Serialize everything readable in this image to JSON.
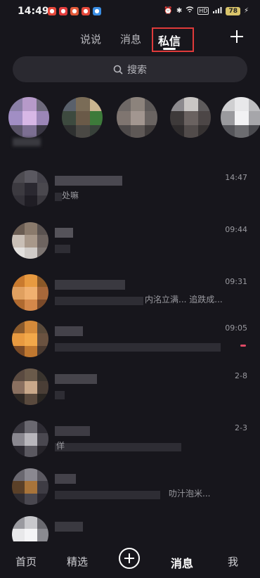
{
  "status_bar": {
    "time": "14:49",
    "signal_label": "5G",
    "hd_label": "HD",
    "battery": "78"
  },
  "top_tabs": [
    {
      "label": "说说"
    },
    {
      "label": "消息"
    },
    {
      "label": "私信",
      "active": true
    }
  ],
  "search": {
    "placeholder": "搜索"
  },
  "conversations": [
    {
      "time": "14:47",
      "preview_tail": "处嘛"
    },
    {
      "time": "09:44",
      "preview_tail": ""
    },
    {
      "time": "09:31",
      "preview_tail": "内洺立满...  追跌成..."
    },
    {
      "time": "09:05",
      "preview_tail": "",
      "unread": true
    },
    {
      "time": "2-8",
      "preview_tail": ""
    },
    {
      "time": "2-3",
      "preview_tail": "佯"
    },
    {
      "time": "",
      "preview_tail": "叻汁泡米..."
    },
    {
      "time": "",
      "preview_tail": ""
    }
  ],
  "bottom_nav": [
    {
      "label": "首页"
    },
    {
      "label": "精选"
    },
    {
      "label": "消息",
      "active": true
    },
    {
      "label": "我"
    }
  ],
  "colors": {
    "background": "#17161c",
    "search_bg": "#2a2930",
    "highlight": "#e03a3a",
    "unread": "#e04a66"
  }
}
